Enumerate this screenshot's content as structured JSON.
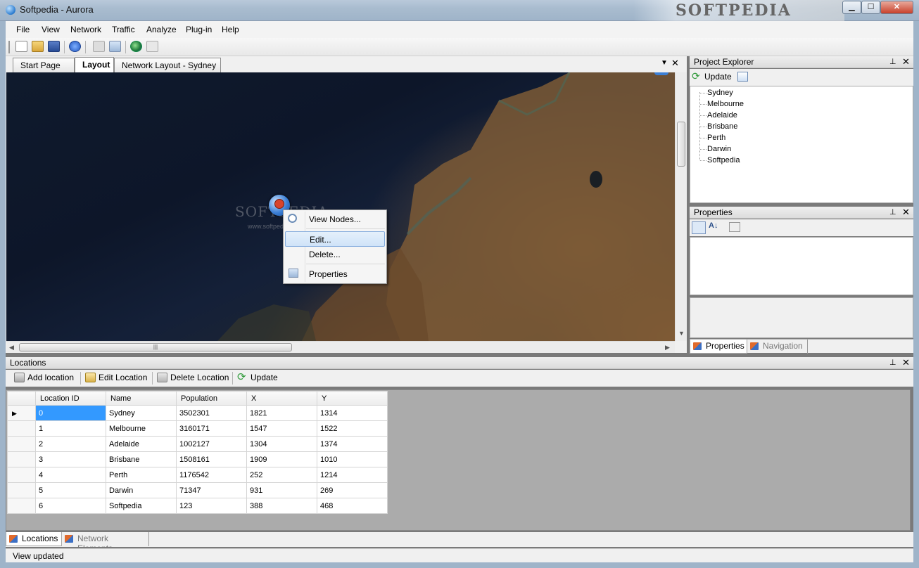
{
  "window": {
    "title": "Softpedia - Aurora",
    "watermark": "SOFTPEDIA",
    "minimize": "▁",
    "maximize": "☐",
    "close": "✕"
  },
  "menu": [
    "File",
    "View",
    "Network",
    "Traffic",
    "Analyze",
    "Plug-in",
    "Help"
  ],
  "document_tabs": [
    {
      "label": "Start Page",
      "active": false
    },
    {
      "label": "Layout",
      "active": true
    },
    {
      "label": "Network Layout - Sydney",
      "active": false
    }
  ],
  "map": {
    "watermark": "SOFTPEDIA",
    "watermark_url": "www.softpedia.com",
    "pin_color": "#3b7fd6"
  },
  "context_menu": [
    {
      "label": "View Nodes...",
      "icon": "magnifier-icon",
      "selected": false
    },
    {
      "label": "Edit...",
      "icon": "",
      "selected": true
    },
    {
      "label": "Delete...",
      "icon": "",
      "selected": false
    },
    {
      "label": "Properties",
      "icon": "properties-icon",
      "selected": false
    }
  ],
  "project_explorer": {
    "title": "Project Explorer",
    "update_label": "Update",
    "items": [
      "Sydney",
      "Melbourne",
      "Adelaide",
      "Brisbane",
      "Perth",
      "Darwin",
      "Softpedia"
    ]
  },
  "properties": {
    "title": "Properties",
    "tabs": [
      {
        "label": "Properties",
        "active": true
      },
      {
        "label": "Navigation",
        "active": false
      }
    ]
  },
  "locations": {
    "title": "Locations",
    "toolbar": {
      "add": "Add location",
      "edit": "Edit Location",
      "delete": "Delete Location",
      "update": "Update"
    },
    "columns": [
      "Location ID",
      "Name",
      "Population",
      "X",
      "Y"
    ],
    "rows": [
      [
        "0",
        "Sydney",
        "3502301",
        "1821",
        "1314"
      ],
      [
        "1",
        "Melbourne",
        "3160171",
        "1547",
        "1522"
      ],
      [
        "2",
        "Adelaide",
        "1002127",
        "1304",
        "1374"
      ],
      [
        "3",
        "Brisbane",
        "1508161",
        "1909",
        "1010"
      ],
      [
        "4",
        "Perth",
        "1176542",
        "252",
        "1214"
      ],
      [
        "5",
        "Darwin",
        "71347",
        "931",
        "269"
      ],
      [
        "6",
        "Softpedia",
        "123",
        "388",
        "468"
      ]
    ],
    "tabs": [
      {
        "label": "Locations",
        "active": true
      },
      {
        "label": "Network Elements",
        "active": false
      }
    ]
  },
  "status": "View updated",
  "colors": {
    "selection": "#3399ff",
    "menu_highlight": "#cfe3f8",
    "frame": "#9fb4c9"
  }
}
